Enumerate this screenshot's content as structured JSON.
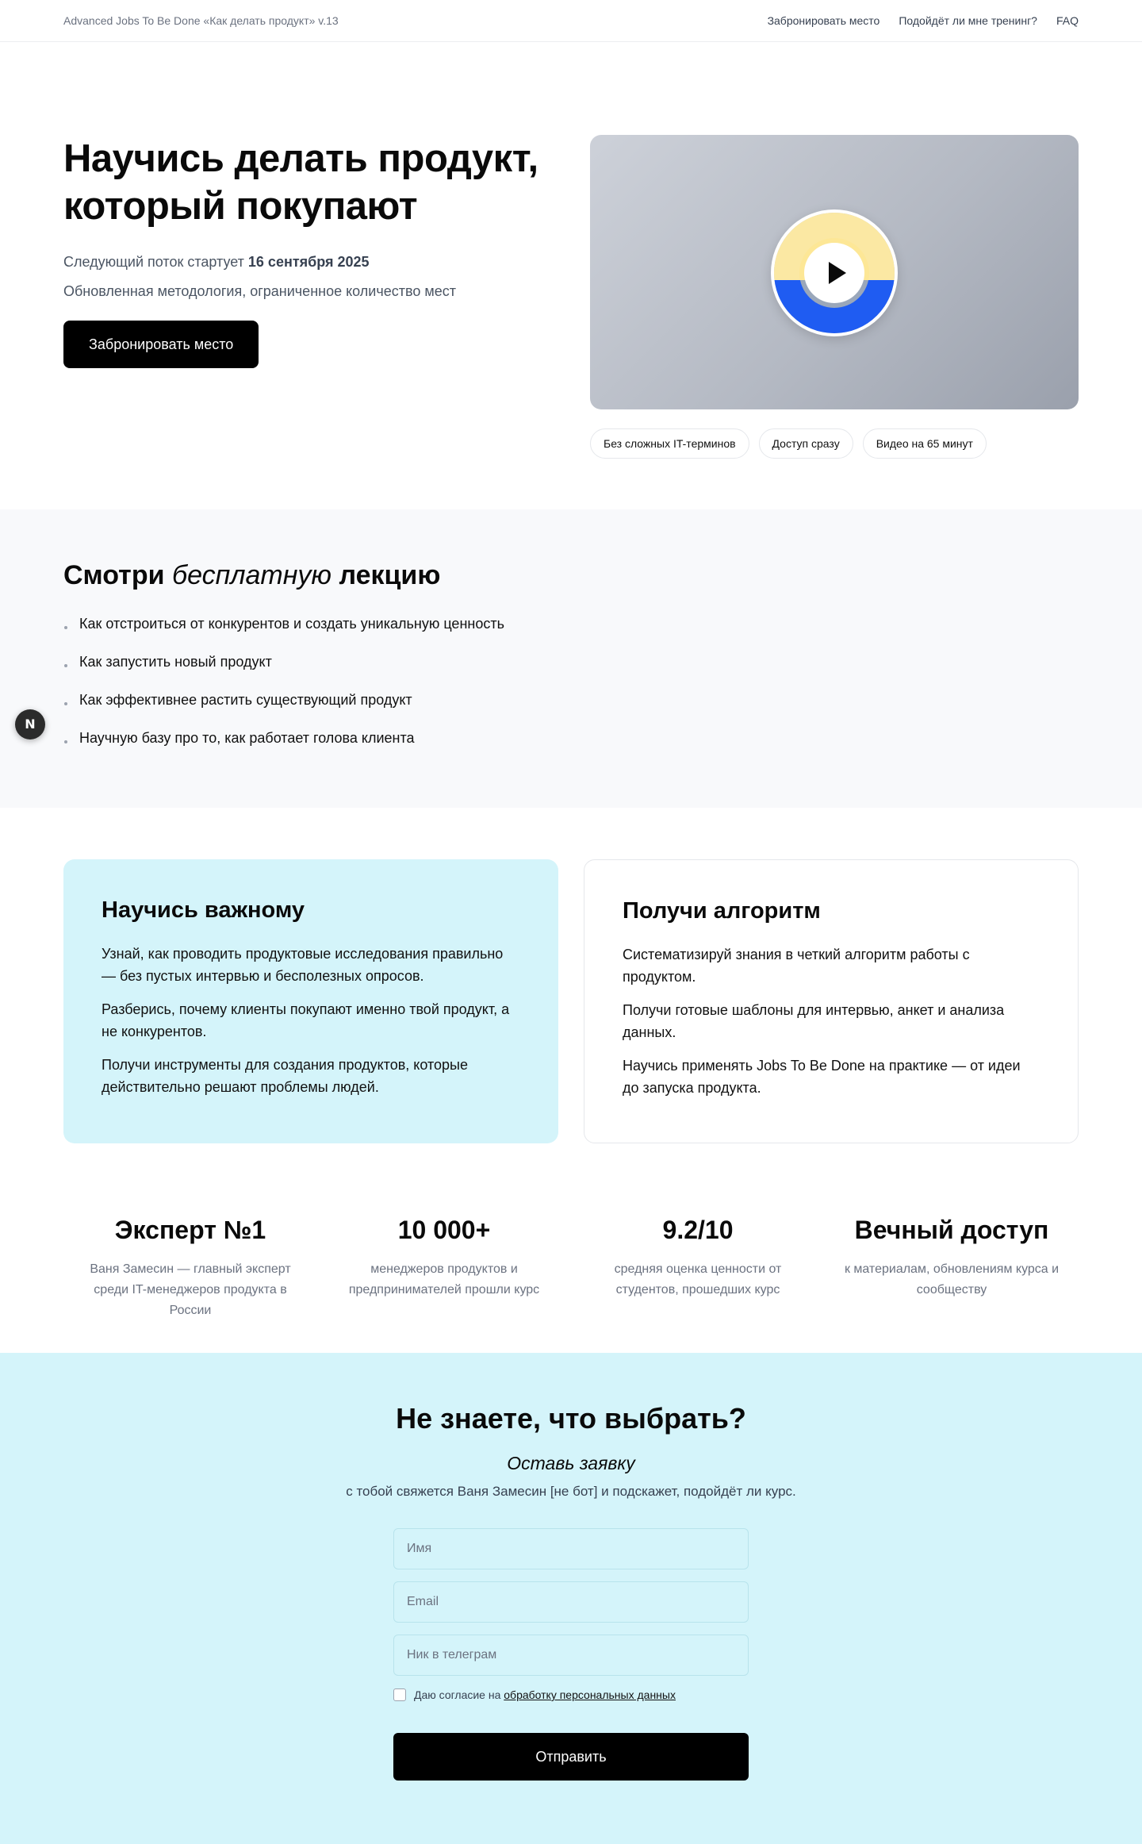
{
  "header": {
    "brand": "Advanced Jobs To Be Done «Как делать продукт» v.13",
    "nav": [
      "Забронировать место",
      "Подойдёт ли мне тренинг?",
      "FAQ"
    ]
  },
  "hero": {
    "title_line1": "Научись делать продукт,",
    "title_line2": "который покупают",
    "start_prefix": "Следующий поток стартует ",
    "start_date": "16 сентября 2025",
    "subtitle": "Обновленная методология, ограниченное количество мест",
    "cta": "Забронировать место",
    "tags": [
      "Без сложных IT-терминов",
      "Доступ сразу",
      "Видео на 65 минут"
    ]
  },
  "lecture": {
    "title_pre": "Смотри ",
    "title_em": "бесплатную",
    "title_post": " лекцию",
    "items": [
      "Как отстроиться от конкурентов и создать уникальную ценность",
      "Как запустить новый продукт",
      "Как эффективнее растить существующий продукт",
      "Научную базу про то, как работает голова клиента"
    ],
    "badge": "N"
  },
  "cards": [
    {
      "title": "Научись важному",
      "paragraphs": [
        "Узнай, как проводить продуктовые исследования правильно — без пустых интервью и бесполезных опросов.",
        "Разберись, почему клиенты покупают именно твой продукт, а не конкурентов.",
        "Получи инструменты для создания продуктов, которые действительно решают проблемы людей."
      ]
    },
    {
      "title": "Получи алгоритм",
      "paragraphs": [
        "Систематизируй знания в четкий алгоритм работы с продуктом.",
        "Получи готовые шаблоны для интервью, анкет и анализа данных.",
        "Научись применять Jobs To Be Done на практике — от идеи до запуска продукта."
      ]
    }
  ],
  "stats": [
    {
      "title": "Эксперт №1",
      "desc": "Ваня Замесин — главный эксперт среди IT-менеджеров продукта в России"
    },
    {
      "title": "10 000+",
      "desc": "менеджеров продуктов и предпринимателей прошли курс"
    },
    {
      "title": "9.2/10",
      "desc": "средняя оценка ценности от студентов, прошедших курс"
    },
    {
      "title": "Вечный доступ",
      "desc": "к материалам, обновлениям курса и сообществу"
    }
  ],
  "form": {
    "title": "Не знаете, что выбрать?",
    "subtitle": "Оставь заявку",
    "note": "с тобой свяжется Ваня Замесин [не бот] и подскажет, подойдёт ли курс.",
    "name_placeholder": "Имя",
    "email_placeholder": "Email",
    "telegram_placeholder": "Ник в телеграм",
    "consent_text": "Даю согласие на ",
    "consent_link": "обработку персональных данных",
    "submit": "Отправить"
  },
  "colors": {
    "accent_cyan": "#d4f4fa",
    "disc_yellow": "#fbe8a3",
    "disc_blue": "#1f5cf2",
    "button_black": "#000000"
  }
}
